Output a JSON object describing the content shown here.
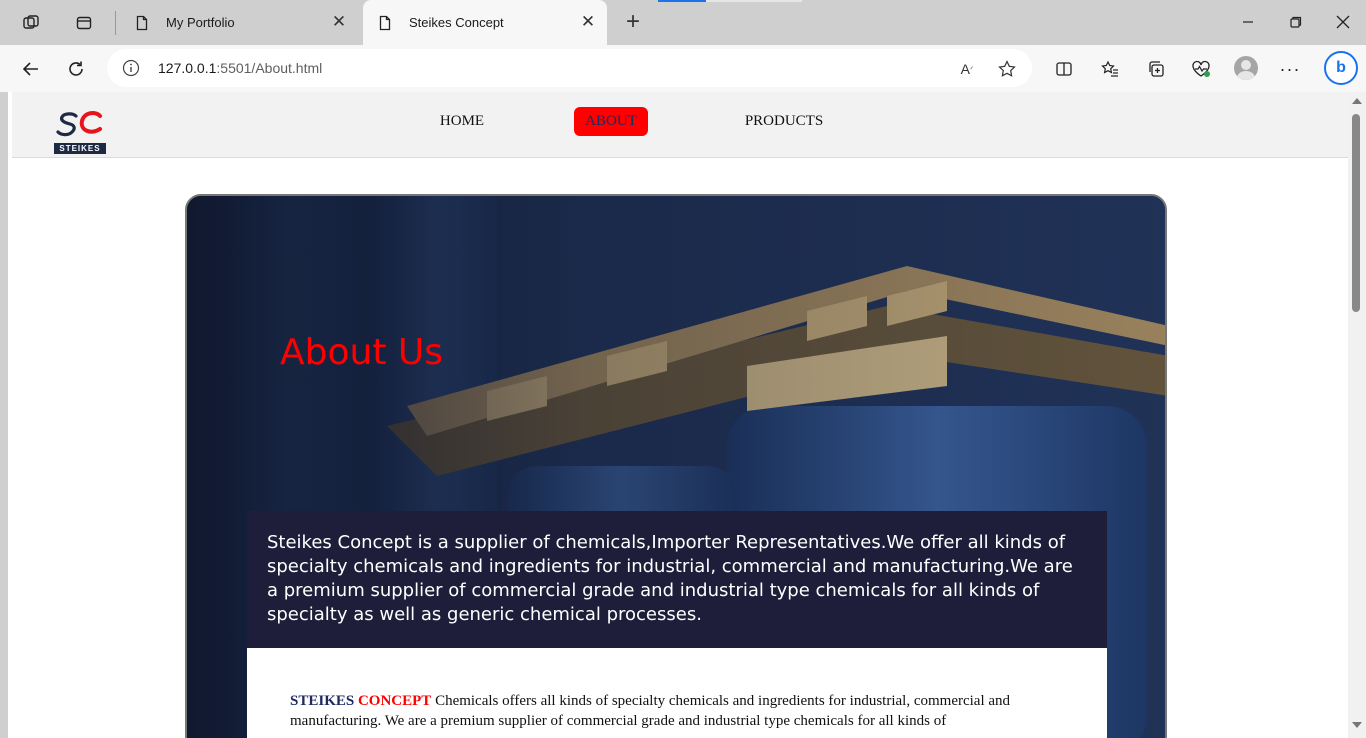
{
  "browser": {
    "tabs": [
      {
        "title": "My Portfolio",
        "active": false
      },
      {
        "title": "Steikes Concept",
        "active": true
      }
    ],
    "address": {
      "host": "127.0.0.1",
      "rest": ":5501/About.html"
    },
    "accent": "#1a73e8"
  },
  "site": {
    "logo": {
      "letters": "SC",
      "word": "STEIKES"
    },
    "nav": [
      {
        "label": "HOME",
        "active": false
      },
      {
        "label": "ABOUT",
        "active": true
      },
      {
        "label": "PRODUCTS",
        "active": false
      }
    ],
    "hero": {
      "title": "About Us",
      "intro": "Steikes Concept is a supplier of chemicals,Importer Representatives.We offer all kinds of specialty chemicals and ingredients for industrial, commercial and manufacturing.We are a premium supplier of commercial grade and industrial type chemicals for all kinds of specialty as well as generic chemical processes."
    },
    "detail": {
      "brand_a": "STEIKES",
      "brand_b": "CONCEPT",
      "text": " Chemicals offers all kinds of specialty chemicals and ingredients for industrial, commercial and manufacturing. We are a premium supplier of commercial grade and industrial type chemicals for all kinds of"
    },
    "colors": {
      "accent": "#ff0000",
      "navy": "#1e2a60",
      "panel": "#1e1e3a"
    }
  }
}
